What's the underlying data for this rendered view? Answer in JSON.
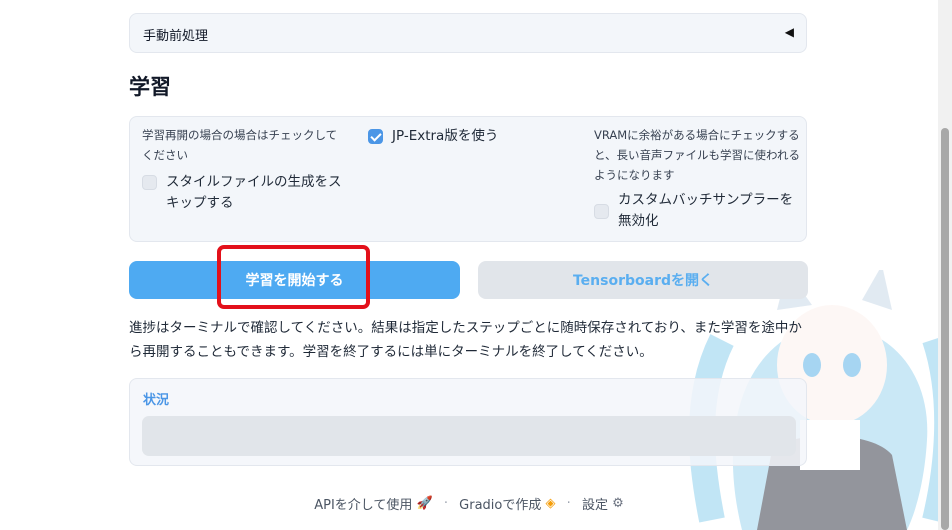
{
  "accordion": {
    "label": "手動前処理",
    "icon": "triangle-left-icon"
  },
  "section": {
    "title": "学習"
  },
  "options": {
    "resume_info": "学習再開の場合の場合はチェックしてください",
    "skip_style_label": "スタイルファイルの生成をスキップする",
    "skip_style_checked": false,
    "jp_extra_label": "JP-Extra版を使う",
    "jp_extra_checked": true,
    "vram_info": "VRAMに余裕がある場合にチェックすると、長い音声ファイルも学習に使われるようになります",
    "custom_batch_label": "カスタムバッチサンプラーを無効化",
    "custom_batch_checked": false
  },
  "buttons": {
    "start_training": "学習を開始する",
    "open_tensorboard": "Tensorboardを開く"
  },
  "description": "進捗はターミナルで確認してください。結果は指定したステップごとに随時保存されており、また学習を途中から再開することもできます。学習を終了するには単にターミナルを終了してください。",
  "status": {
    "label": "状況",
    "value": ""
  },
  "footer": {
    "api": "APIを介して使用",
    "gradio": "Gradioで作成",
    "settings": "設定",
    "separator": "·"
  },
  "colors": {
    "primary": "#4eaaf2",
    "highlight": "#e3101a",
    "accent_text": "#4b96e6"
  }
}
